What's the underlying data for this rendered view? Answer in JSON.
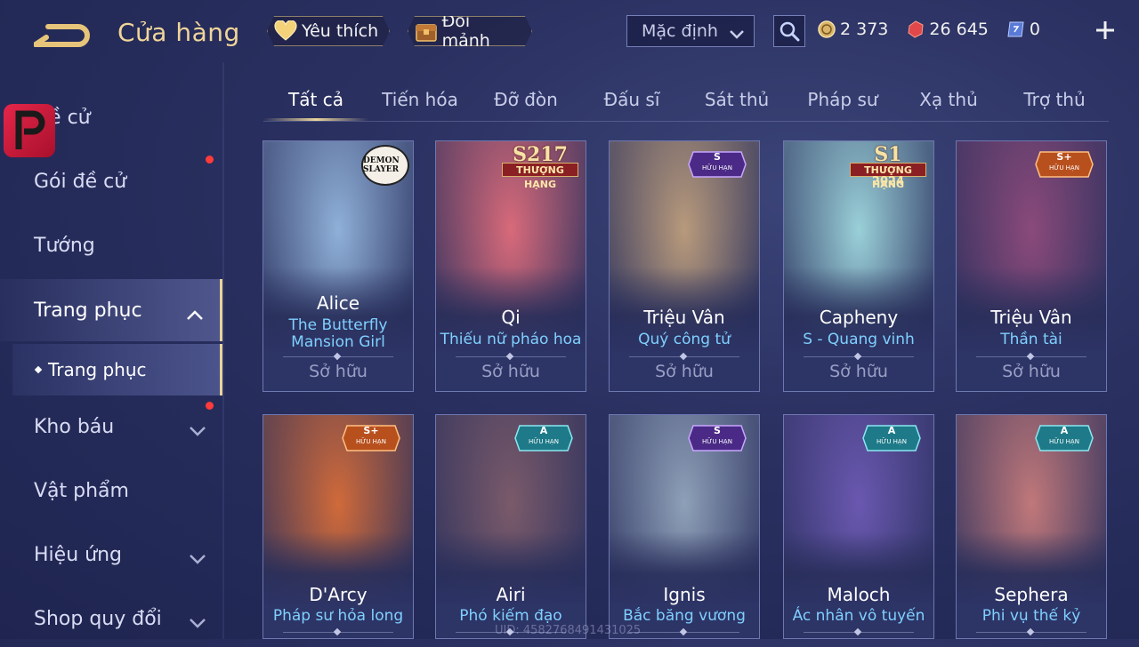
{
  "header": {
    "title": "Cửa hàng",
    "favorites_label": "Yêu thích",
    "exchange_label": "Đổi mảnh",
    "sort_selected": "Mặc định",
    "currencies": [
      {
        "name": "gold",
        "value": "2 373"
      },
      {
        "name": "diamond",
        "value": "26 645"
      },
      {
        "name": "voucher",
        "value": "0"
      }
    ]
  },
  "sidebar": {
    "items": [
      {
        "label": "Đề cử"
      },
      {
        "label": "Gói đề cử"
      },
      {
        "label": "Tướng"
      },
      {
        "label": "Trang phục"
      },
      {
        "label": "Trang phục"
      },
      {
        "label": "Kho báu"
      },
      {
        "label": "Vật phẩm"
      },
      {
        "label": "Hiệu ứng"
      },
      {
        "label": "Shop quy đổi"
      }
    ]
  },
  "tabs": [
    "Tất cả",
    "Tiến hóa",
    "Đỡ đòn",
    "Đấu sĩ",
    "Sát thủ",
    "Pháp sư",
    "Xạ thủ",
    "Trợ thủ"
  ],
  "cards": [
    {
      "hero": "Alice",
      "skin": "The Butterfly Mansion Girl",
      "status": "Sở hữu",
      "badge": "DEMON SLAYER",
      "color": "#8fb0d8"
    },
    {
      "hero": "Qi",
      "skin": "Thiếu nữ pháo hoa",
      "status": "Sở hữu",
      "badge_top": "S217",
      "badge_mid": "THƯỢNG HẠNG",
      "color": "#d86a7a"
    },
    {
      "hero": "Triệu Vân",
      "skin": "Quý công tử",
      "status": "Sở hữu",
      "badge_top": "S",
      "badge_bottom": "HỮU HẠN",
      "color": "#b89a7c"
    },
    {
      "hero": "Capheny",
      "skin": "S - Quang vinh",
      "status": "Sở hữu",
      "badge_top": "S1",
      "badge_mid": "THƯỢNG HẠNG",
      "badge_bottom": "2024",
      "color": "#9ad0d8"
    },
    {
      "hero": "Triệu Vân",
      "skin": "Thần tài",
      "status": "Sở hữu",
      "badge_top": "S+",
      "badge_bottom": "HỮU HẠN",
      "color": "#8a4a7a"
    },
    {
      "hero": "D'Arcy",
      "skin": "Pháp sư hỏa long",
      "badge_top": "S+",
      "badge_bottom": "HỮU HẠN",
      "color": "#d06a3a"
    },
    {
      "hero": "Airi",
      "skin": "Phó kiếm đạo",
      "badge_top": "A",
      "badge_bottom": "HỮU HẠN",
      "color": "#7a5a6a"
    },
    {
      "hero": "Ignis",
      "skin": "Bắc băng vương",
      "badge_top": "S",
      "badge_bottom": "HỮU HẠN",
      "color": "#8ea0b8"
    },
    {
      "hero": "Maloch",
      "skin": "Ác nhân vô tuyến",
      "badge_top": "A",
      "badge_bottom": "HỮU HẠN",
      "color": "#6a58b0"
    },
    {
      "hero": "Sephera",
      "skin": "Phi vụ thế kỷ",
      "badge_top": "A",
      "badge_bottom": "HỮU HẠN",
      "color": "#c0787a"
    }
  ],
  "footer": {
    "uid": "UID: 4582768491431025"
  },
  "colors": {
    "accent_gold": "#e9d49a",
    "skin_name": "#7fd0ff",
    "notification": "#ff3b3b"
  }
}
